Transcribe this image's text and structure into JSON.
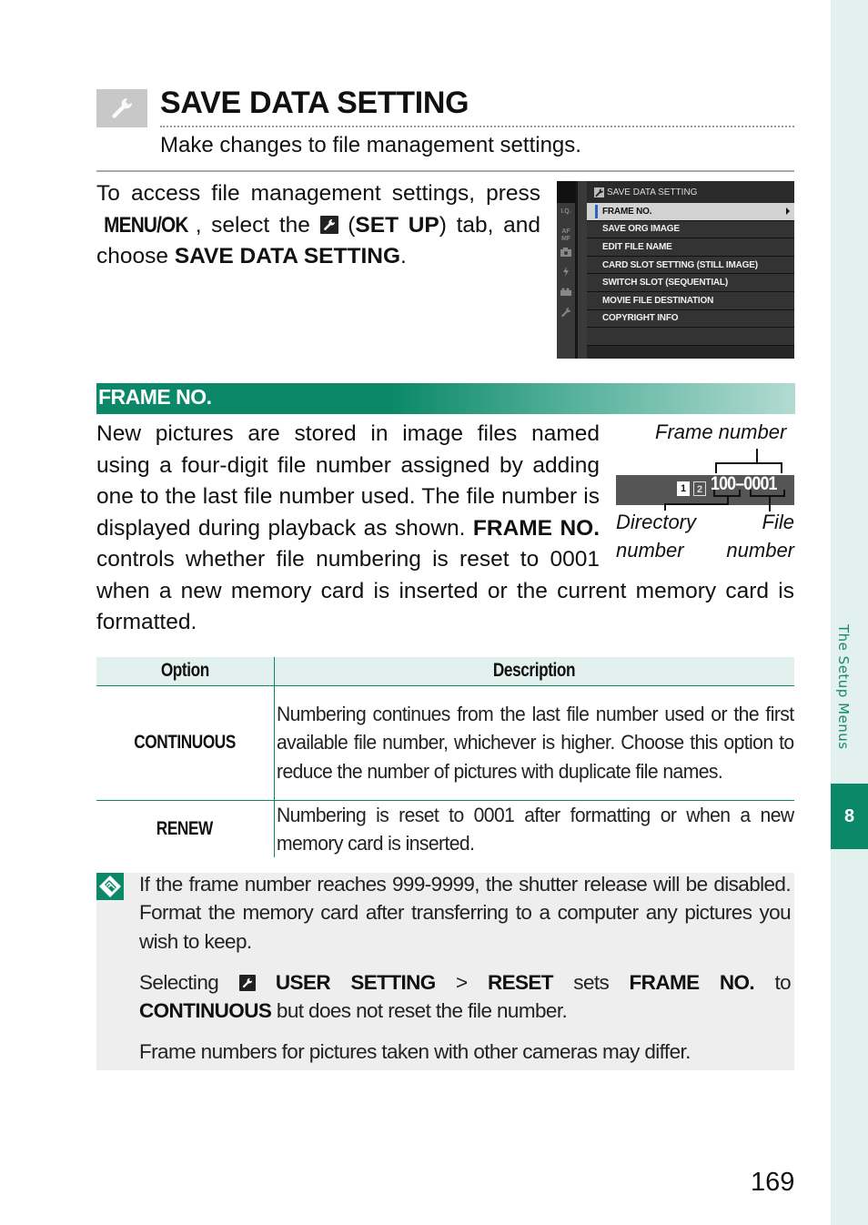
{
  "page": {
    "title": "SAVE DATA SETTING",
    "subtitle": "Make changes to file management settings.",
    "page_number": "169",
    "side_label": "The Setup Menus",
    "chapter_number": "8"
  },
  "intro": {
    "part1": "To access file management settings, press ",
    "menu_button": "MENU/OK",
    "part2": ", select the ",
    "tab_icon": "wrench-icon",
    "paren_open": " (",
    "tab_name": "SET UP",
    "part3": ") tab, and choose ",
    "menu_name": "SAVE DATA SETTING",
    "part4": "."
  },
  "camera_screen": {
    "header": "SAVE DATA SETTING",
    "side_tabs": [
      "I.Q.",
      "AF MF",
      "camera-icon",
      "flash-icon",
      "movie-icon",
      "wrench-icon"
    ],
    "items": [
      {
        "label": "FRAME NO.",
        "selected": true
      },
      {
        "label": "SAVE ORG IMAGE",
        "selected": false
      },
      {
        "label": "EDIT FILE NAME",
        "selected": false
      },
      {
        "label": "CARD SLOT SETTING (STILL IMAGE)",
        "selected": false
      },
      {
        "label": "SWITCH SLOT (SEQUENTIAL)",
        "selected": false
      },
      {
        "label": "MOVIE FILE DESTINATION",
        "selected": false
      },
      {
        "label": "COPYRIGHT INFO",
        "selected": false
      }
    ]
  },
  "frame_no": {
    "heading": "FRAME NO.",
    "body_part1": "New pictures are stored in image files named using a four-digit file number assigned by adding one to the last file number used. The file number is displayed during playback as shown. ",
    "body_bold": "FRAME NO.",
    "body_part2": " controls whether file numbering is reset to 0001 when a new memory card is inserted or the current memory card is formatted.",
    "figure": {
      "label_top": "Frame number",
      "label_left_1": "Directory",
      "label_left_2": "number",
      "label_right_1": "File",
      "label_right_2": "number",
      "slot1": "1",
      "slot2": "2",
      "frame_value": "100–0001"
    }
  },
  "table": {
    "headers": [
      "Option",
      "Description"
    ],
    "rows": [
      {
        "option": "CONTINUOUS",
        "description": "Numbering continues from the last file number used or the first available file number, whichever is higher.  Choose this option to reduce the number of pictures with duplicate file names."
      },
      {
        "option": "RENEW",
        "description": "Numbering is reset to 0001 after formatting or when a new memory card is inserted."
      }
    ]
  },
  "note": {
    "p1": "If the frame number reaches 999-9999, the shutter release will be disabled.  Format the memory card after transferring to a computer any pictures you wish to keep.",
    "p2_a": "Selecting ",
    "p2_b": "USER SETTING",
    "p2_c": " > ",
    "p2_d": "RESET",
    "p2_e": " sets ",
    "p2_f": "FRAME NO.",
    "p2_g": " to ",
    "p2_h": "CONTINUOUS",
    "p2_i": " but does not reset the file number.",
    "p3": "Frame numbers for pictures taken with other cameras may differ."
  },
  "colors": {
    "accent_green": "#0a8868",
    "side_strip": "#e2f1ee",
    "note_bg": "#eeeeee",
    "camera_bg": "#333333",
    "selection_blue": "#2a62c8"
  }
}
